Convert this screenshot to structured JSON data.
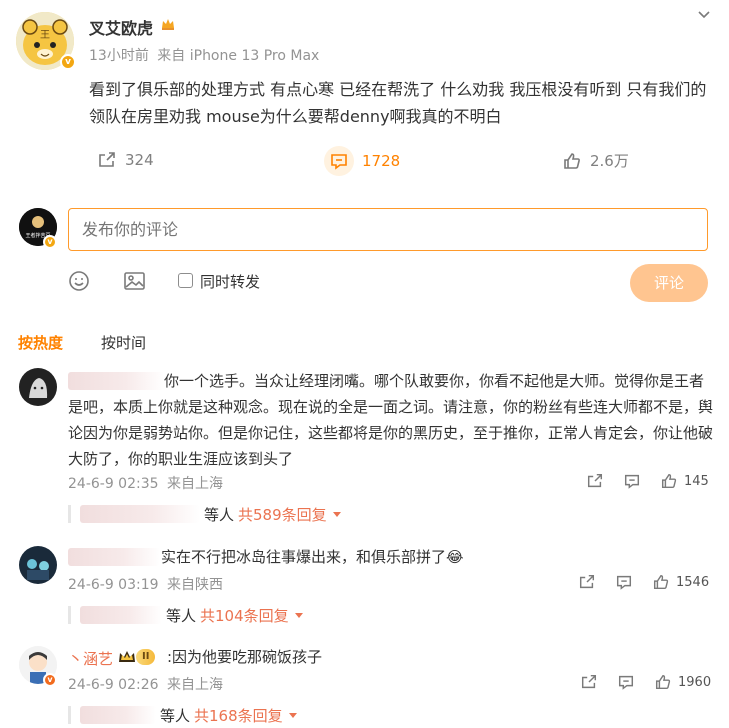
{
  "post": {
    "author": "叉艾欧虎",
    "time": "13小时前",
    "source": "来自 iPhone 13 Pro Max",
    "content": "看到了俱乐部的处理方式 有点心寒 已经在帮洗了 什么劝我 我压根没有听到 只有我们的领队在房里劝我 mouse为什么要帮denny啊我真的不明白",
    "reposts": "324",
    "comments": "1728",
    "likes": "2.6万"
  },
  "compose": {
    "placeholder": "发布你的评论",
    "repost_label": "同时转发",
    "submit_label": "评论",
    "my_avatar_text": "王者拌苦豆"
  },
  "tabs": [
    {
      "label": "按热度",
      "active": true
    },
    {
      "label": "按时间",
      "active": false
    }
  ],
  "comments": [
    {
      "text": "你一个选手。当众让经理闭嘴。哪个队敢要你，你看不起他是大师。觉得你是王者是吧，本质上你就是这种观念。现在说的全是一面之词。请注意，你的粉丝有些连大师都不是，舆论因为你是弱势站你。但是你记住，这些都将是你的黑历史，至于推你，正常人肯定会，你让他破大防了，你的职业生涯应该到头了",
      "time": "24-6-9 02:35",
      "location": "来自上海",
      "likes": "145",
      "reply_suffix": "等人",
      "reply_count": "共589条回复"
    },
    {
      "text": "实在不行把冰岛往事爆出来，和俱乐部拼了😂",
      "time": "24-6-9 03:19",
      "location": "来自陕西",
      "likes": "1546",
      "reply_suffix": "等人",
      "reply_count": "共104条回复"
    },
    {
      "user": "丶涵艺",
      "badge": "II",
      "text": ":因为他要吃那碗饭孩子",
      "time": "24-6-9 02:26",
      "location": "来自上海",
      "likes": "1960",
      "reply_suffix": "等人",
      "reply_count": "共168条回复"
    }
  ],
  "colors": {
    "accent": "#ff8200",
    "link": "#eb7350",
    "muted": "#939393",
    "submit_disabled": "#ffc590"
  }
}
